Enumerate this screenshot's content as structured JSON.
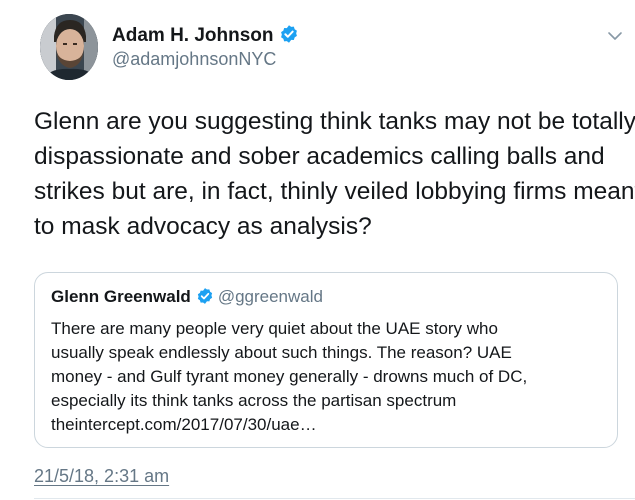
{
  "author": {
    "display_name": "Adam H. Johnson",
    "handle": "@adamjohnsonNYC",
    "verified_icon": "verified-badge-icon",
    "avatar_icon": "avatar-photo"
  },
  "tweet": {
    "text_lines": [
      "Glenn are you suggesting think tanks may not be totally",
      "dispassionate and sober academics calling balls and",
      "strikes but are, in fact, thinly veiled lobbying firms meant",
      "to mask advocacy as analysis?"
    ],
    "timestamp": "21/5/18, 2:31 am",
    "menu_icon": "chevron-down-icon"
  },
  "quoted_tweet": {
    "display_name": "Glenn Greenwald",
    "handle": "@ggreenwald",
    "verified_icon": "verified-badge-icon",
    "text_lines": [
      "There are many people very quiet about the UAE story who",
      "usually speak endlessly about such things. The reason? UAE",
      "money - and Gulf tyrant money generally - drowns much of DC,",
      "especially its think tanks across the partisan spectrum",
      "theintercept.com/2017/07/30/uae…"
    ]
  },
  "colors": {
    "text": "#14171a",
    "secondary": "#657786",
    "verified": "#1da1f2",
    "border": "#ccd6dd"
  }
}
